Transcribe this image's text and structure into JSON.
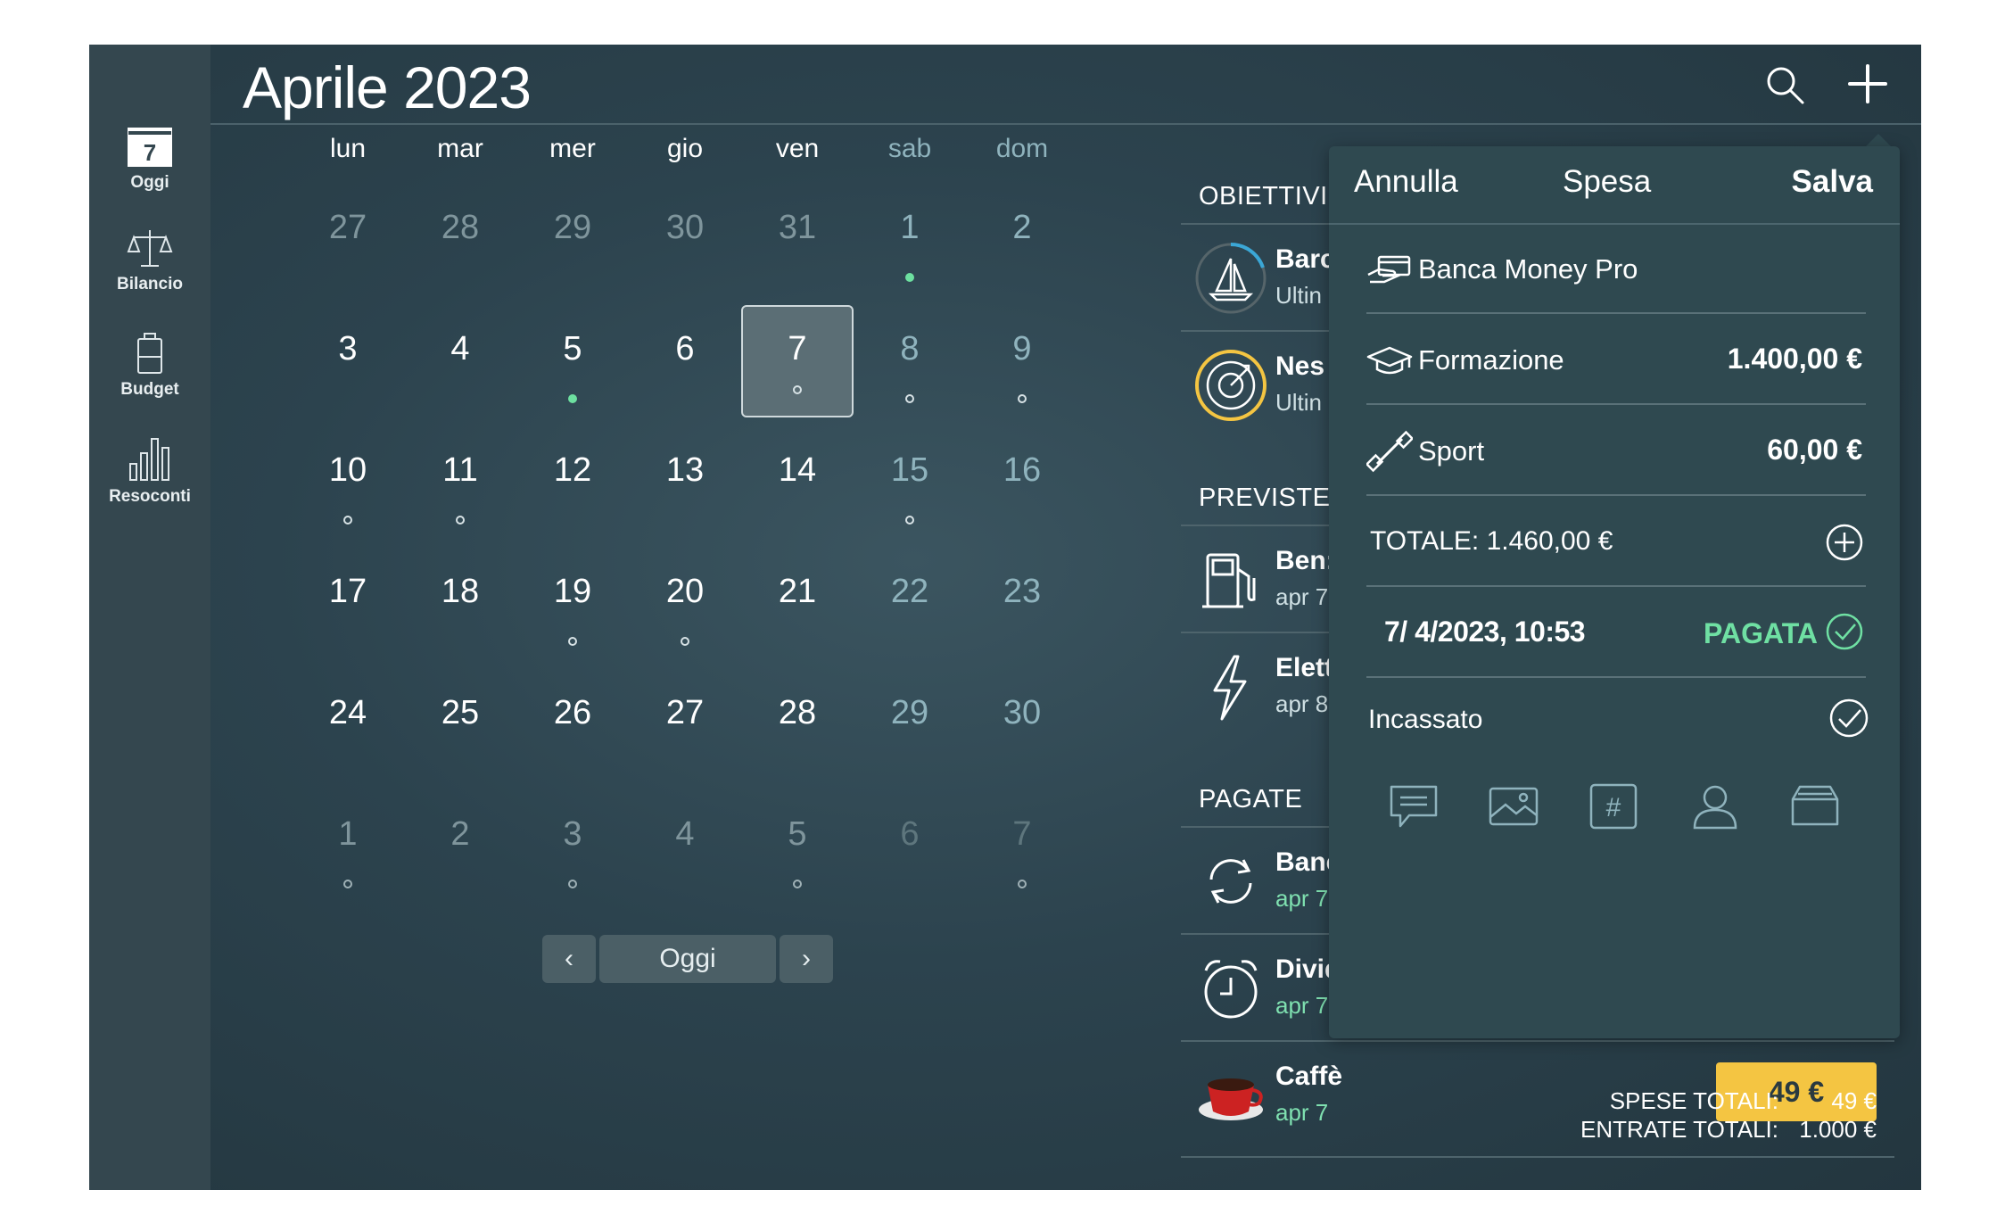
{
  "sidebar": {
    "items": [
      {
        "label": "Oggi",
        "icon": "calendar-day-icon",
        "day": "7"
      },
      {
        "label": "Bilancio",
        "icon": "scales-icon"
      },
      {
        "label": "Budget",
        "icon": "battery-icon"
      },
      {
        "label": "Resoconti",
        "icon": "bar-chart-icon"
      }
    ]
  },
  "header": {
    "title": "Aprile 2023",
    "search_icon": "search-icon",
    "add_icon": "plus-icon"
  },
  "calendar": {
    "weekdays": [
      "lun",
      "mar",
      "mer",
      "gio",
      "ven",
      "sab",
      "dom"
    ],
    "weeks": [
      [
        "27",
        "28",
        "29",
        "30",
        "31",
        "1",
        "2"
      ],
      [
        "3",
        "4",
        "5",
        "6",
        "7",
        "8",
        "9"
      ],
      [
        "10",
        "11",
        "12",
        "13",
        "14",
        "15",
        "16"
      ],
      [
        "17",
        "18",
        "19",
        "20",
        "21",
        "22",
        "23"
      ],
      [
        "24",
        "25",
        "26",
        "27",
        "28",
        "29",
        "30"
      ],
      [
        "1",
        "2",
        "3",
        "4",
        "5",
        "6",
        "7"
      ]
    ],
    "nav": {
      "prev": "‹",
      "today": "Oggi",
      "next": "›"
    }
  },
  "goals": {
    "title": "OBIETTIVI",
    "items": [
      {
        "name": "Barc",
        "sub": "Ultin",
        "icon": "sailboat-icon"
      },
      {
        "name": "Nes",
        "sub": "Ultin",
        "icon": "target-icon"
      }
    ]
  },
  "planned": {
    "title": "PREVISTE",
    "items": [
      {
        "name": "Ben:",
        "sub": "apr 7",
        "icon": "fuel-pump-icon"
      },
      {
        "name": "Elett",
        "sub": "apr 8",
        "icon": "lightning-icon"
      }
    ]
  },
  "paid": {
    "title": "PAGATE",
    "items": [
      {
        "name": "Banc",
        "sub": "apr 7",
        "icon": "refresh-icon"
      },
      {
        "name": "Divid",
        "sub": "apr 7",
        "icon": "alarm-clock-icon"
      },
      {
        "name": "Caffè",
        "sub": "apr 7",
        "icon": "coffee-cup-icon",
        "amount": "49 €"
      }
    ]
  },
  "totals": {
    "expenses_label": "SPESE TOTALI:",
    "expenses_value": "49 €",
    "income_label": "ENTRATE TOTALI:",
    "income_value": "1.000 €"
  },
  "popover": {
    "cancel": "Annulla",
    "title": "Spesa",
    "save": "Salva",
    "account": "Banca Money Pro",
    "categories": [
      {
        "label": "Formazione",
        "amount": "1.400,00 €",
        "icon": "graduation-cap-icon"
      },
      {
        "label": "Sport",
        "amount": "60,00 €",
        "icon": "dumbbell-icon"
      }
    ],
    "total": "TOTALE: 1.460,00 €",
    "date": "7/  4/2023, 10:53",
    "status": "PAGATA",
    "income_label": "Incassato",
    "attachments": [
      "comment-icon",
      "image-icon",
      "hashtag-icon",
      "person-icon",
      "card-icon"
    ]
  },
  "colors": {
    "accent_green": "#6fe0a3",
    "amount_yellow": "#f4c542",
    "panel": "#2f4950"
  }
}
